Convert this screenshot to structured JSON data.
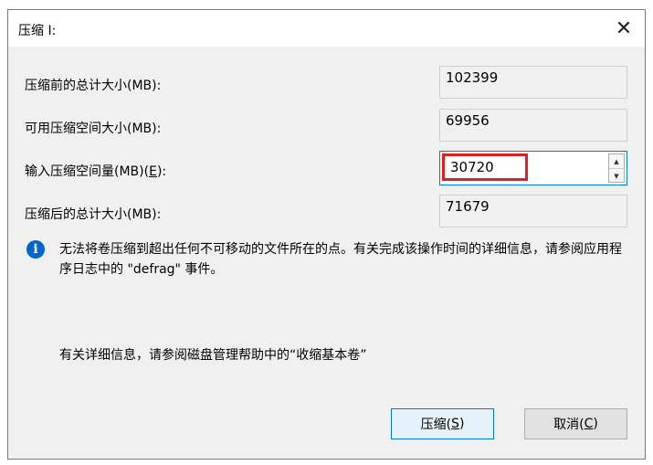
{
  "window": {
    "title": "压缩 I:",
    "close_glyph": "✕"
  },
  "fields": {
    "total_before_label": "压缩前的总计大小(MB):",
    "total_before_value": "102399",
    "available_label": "可用压缩空间大小(MB):",
    "available_value": "69956",
    "amount_label_prefix": "输入压缩空间量(MB)(",
    "amount_label_mnemonic": "E",
    "amount_label_suffix": "):",
    "amount_value": "30720",
    "total_after_label": "压缩后的总计大小(MB):",
    "total_after_value": "71679"
  },
  "info": {
    "icon": "info-icon",
    "text": "无法将卷压缩到超出任何不可移动的文件所在的点。有关完成该操作时间的详细信息，请参阅应用程序日志中的 \"defrag\" 事件。"
  },
  "help": {
    "text": "有关详细信息，请参阅磁盘管理帮助中的“收缩基本卷”"
  },
  "buttons": {
    "shrink_prefix": "压缩(",
    "shrink_mnemonic": "S",
    "shrink_suffix": ")",
    "cancel_prefix": "取消(",
    "cancel_mnemonic": "C",
    "cancel_suffix": ")"
  },
  "colors": {
    "highlight_box": "#e02020",
    "focus_border": "#0078d7",
    "info_icon": "#0066cc"
  }
}
